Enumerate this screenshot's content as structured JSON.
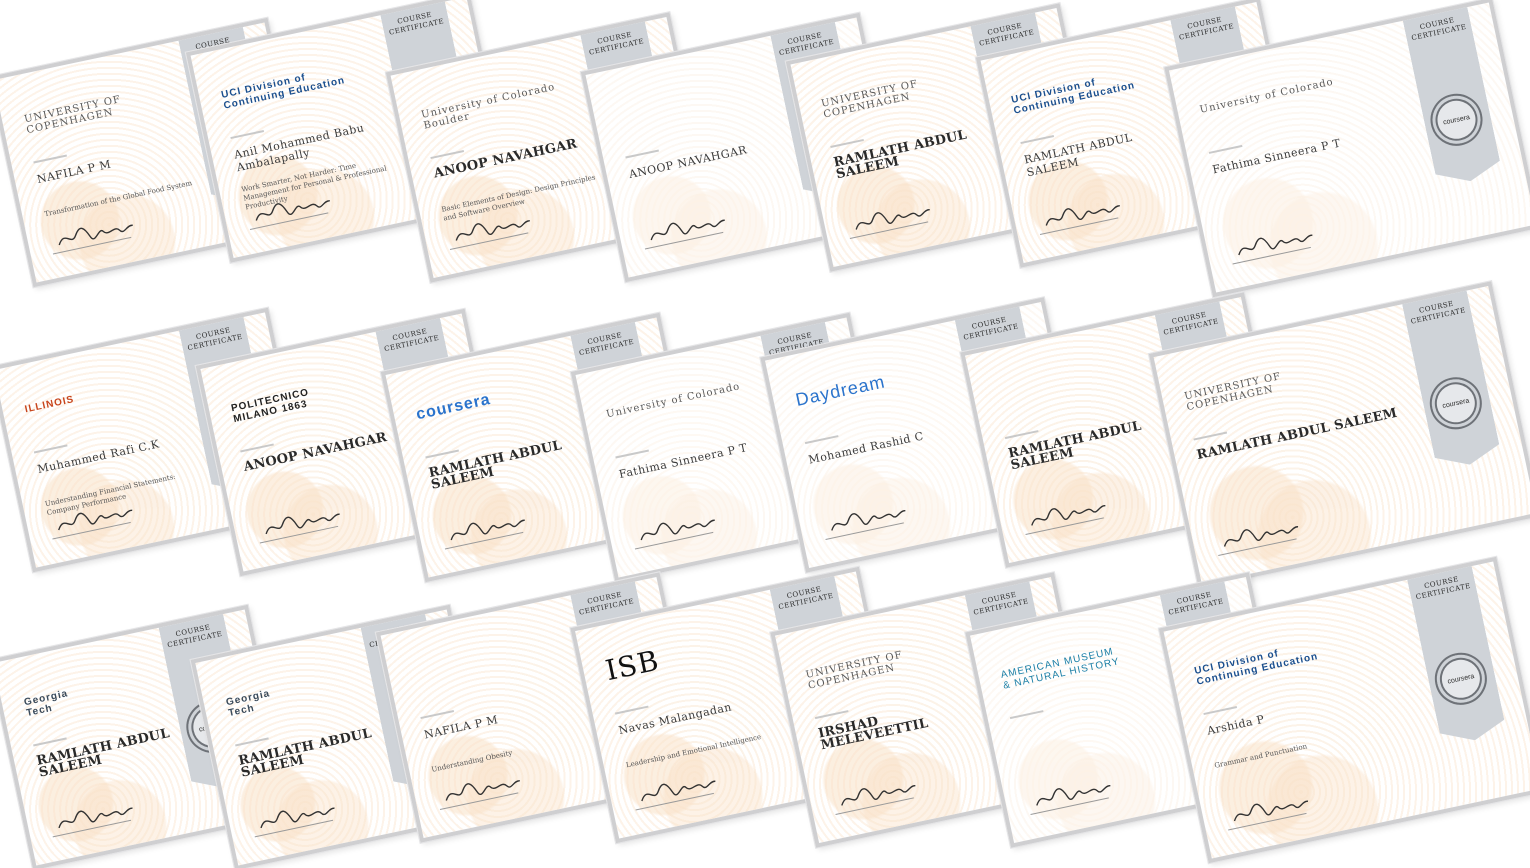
{
  "ribbon_label": "COURSE\nCERTIFICATE",
  "seal_label": "coursera",
  "certificates": [
    {
      "logo": "UNIVERSITY OF\nCOPENHAGEN",
      "name": "NAFILA P M",
      "course": "Transformation of the Global Food System",
      "seal": false,
      "bold": false
    },
    {
      "logo": "UCI Division of\nContinuing Education",
      "name": "Anil Mohammed Babu Ambalapally",
      "course": "Work Smarter, Not Harder: Time Management for Personal & Professional Productivity",
      "seal": false,
      "bold": false
    },
    {
      "logo": "University of Colorado\nBoulder",
      "name": "ANOOP NAVAHGAR",
      "course": "Basic Elements of Design: Design Principles and Software Overview",
      "seal": false,
      "bold": true
    },
    {
      "logo": "",
      "name": "ANOOP NAVAHGAR",
      "course": "",
      "seal": false,
      "bold": false
    },
    {
      "logo": "UNIVERSITY OF\nCOPENHAGEN",
      "name": "RAMLATH ABDUL SALEEM",
      "course": "",
      "seal": false,
      "bold": true
    },
    {
      "logo": "UCI Division of\nContinuing Education",
      "name": "RAMLATH ABDUL SALEEM",
      "course": "",
      "seal": false,
      "bold": false
    },
    {
      "logo": "University of Colorado",
      "name": "Fathima Sinneera P T",
      "course": "",
      "seal": true,
      "bold": false
    },
    {
      "logo": "ILLINOIS",
      "name": "Muhammed Rafi C.K",
      "course": "Understanding Financial Statements: Company Performance",
      "seal": false,
      "bold": false
    },
    {
      "logo": "POLITECNICO\nMILANO 1863",
      "name": "ANOOP NAVAHGAR",
      "course": "",
      "seal": false,
      "bold": true
    },
    {
      "logo": "coursera",
      "name": "RAMLATH ABDUL SALEEM",
      "course": "",
      "seal": false,
      "bold": true
    },
    {
      "logo": "University of Colorado",
      "name": "Fathima Sinneera P T",
      "course": "",
      "seal": false,
      "bold": false
    },
    {
      "logo": "Daydream",
      "name": "Mohamed Rashid C",
      "course": "",
      "seal": false,
      "bold": false
    },
    {
      "logo": "",
      "name": "RAMLATH ABDUL SALEEM",
      "course": "",
      "seal": false,
      "bold": true
    },
    {
      "logo": "UNIVERSITY OF\nCOPENHAGEN",
      "name": "RAMLATH ABDUL SALEEM",
      "course": "",
      "seal": true,
      "bold": true
    },
    {
      "logo": "Georgia\nTech",
      "name": "RAMLATH ABDUL SALEEM",
      "course": "",
      "seal": true,
      "bold": true
    },
    {
      "logo": "Georgia\nTech",
      "name": "RAMLATH ABDUL SALEEM",
      "course": "",
      "seal": false,
      "bold": true
    },
    {
      "logo": "",
      "name": "NAFILA P M",
      "course": "Understanding Obesity",
      "seal": false,
      "bold": false
    },
    {
      "logo": "ISB",
      "name": "Navas Malangadan",
      "course": "Leadership and Emotional Intelligence",
      "seal": false,
      "bold": false
    },
    {
      "logo": "UNIVERSITY OF\nCOPENHAGEN",
      "name": "IRSHAD MELEVEETTIL",
      "course": "",
      "seal": false,
      "bold": true
    },
    {
      "logo": "AMERICAN MUSEUM\n& NATURAL HISTORY",
      "name": "",
      "course": "",
      "seal": false,
      "bold": false
    },
    {
      "logo": "UCI Division of\nContinuing Education",
      "name": "Arshida P",
      "course": "Grammar and Punctuation",
      "seal": true,
      "bold": false
    }
  ]
}
